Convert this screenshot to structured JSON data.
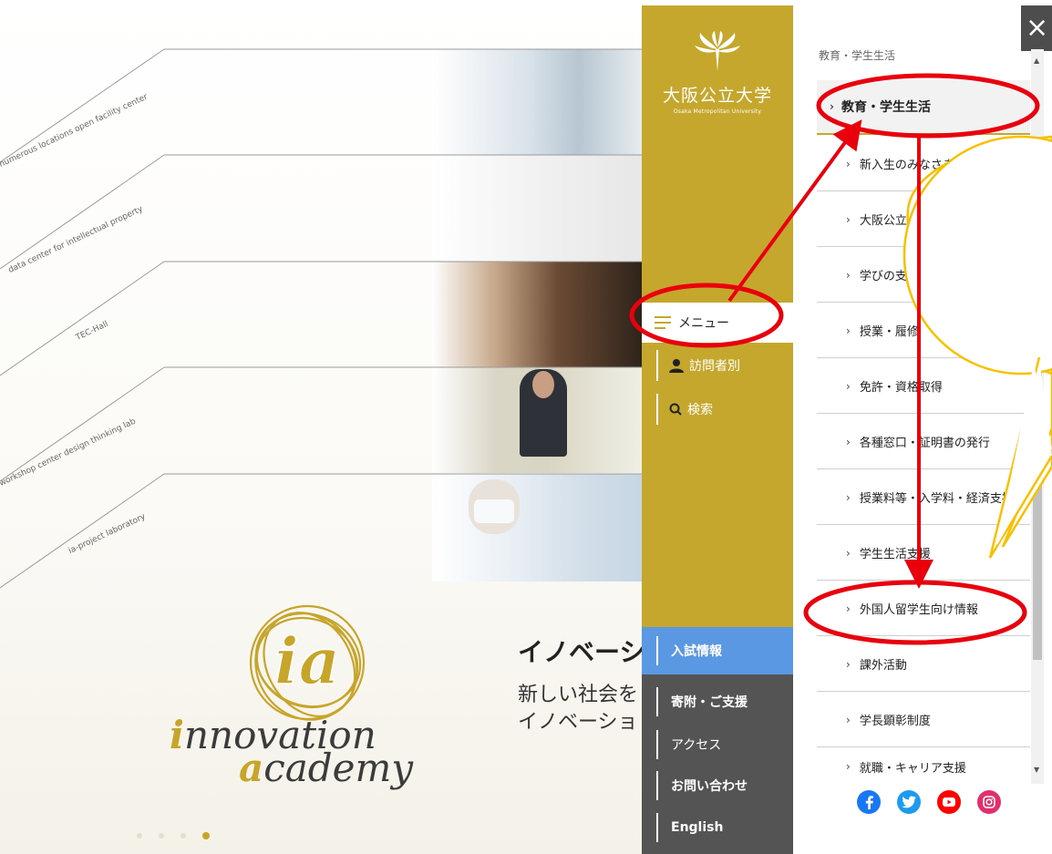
{
  "brand": {
    "name": "大阪公立大学",
    "name_en": "Osaka Metropolitan University"
  },
  "hero": {
    "band_labels": [
      "numerous locations   open facility center",
      "data center for intellectual property",
      "TEC-Hall",
      "workshop center   design thinking lab",
      "ia-project  laboratory"
    ],
    "logo_text_line1": "innovation",
    "logo_text_line2": "academy",
    "title": "イノベーシ",
    "subtitle_line1": "新しい社会を",
    "subtitle_line2": "イノベーショ",
    "carousel": {
      "dots": 4,
      "active_index": 3
    }
  },
  "side_nav": {
    "menu_label": "メニュー",
    "visitor_label": "訪問者別",
    "search_label": "検索",
    "nyushi_label": "入試情報",
    "kifu_label": "寄附・ご支援",
    "access_label": "アクセス",
    "contact_label": "お問い合わせ",
    "english_label": "English"
  },
  "menu_panel": {
    "close_label": "×",
    "breadcrumb": "教育・学生生活",
    "section_title": "教育・学生生活",
    "items": [
      "新入生のみなさまへ",
      "大阪公立大学での学",
      "学びの支援",
      "授業・履修",
      "免許・資格取得",
      "各種窓口・証明書の発行",
      "授業料等・入学料・経済支援",
      "学生生活支援",
      "外国人留学生向け情報",
      "課外活動",
      "学長顕彰制度",
      "就職・キャリア支援"
    ],
    "social": [
      "facebook-icon",
      "twitter-icon",
      "youtube-icon",
      "instagram-icon"
    ]
  },
  "colors": {
    "gold": "#c4a72c",
    "blue": "#5b98e3",
    "dark": "#545454",
    "annotation_red": "#e8000d",
    "annotation_yellow": "#f7c000"
  }
}
